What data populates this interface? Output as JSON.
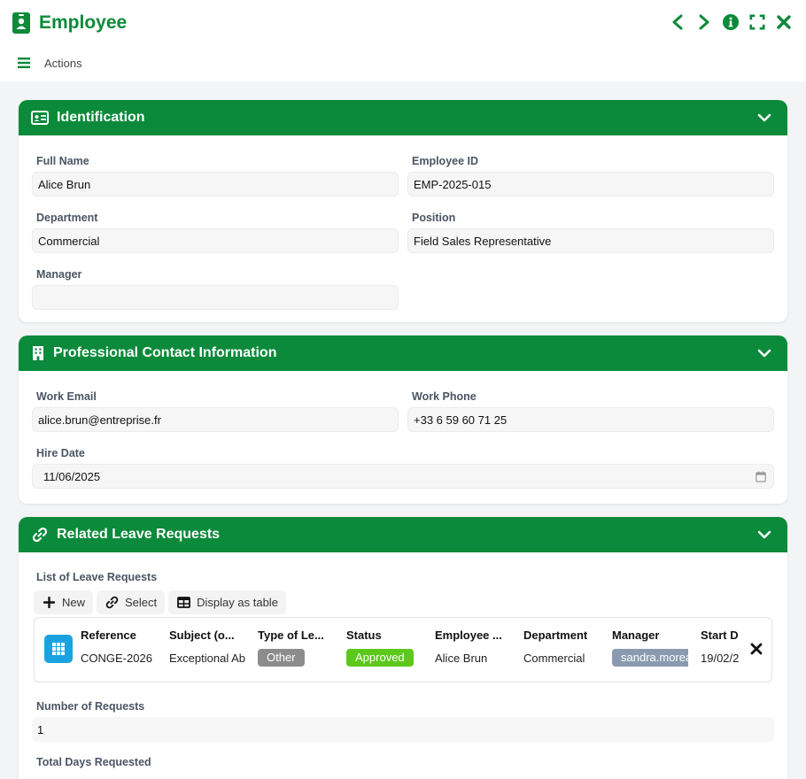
{
  "header": {
    "title": "Employee",
    "actions_label": "Actions"
  },
  "colors": {
    "brand": "#0a8a3a",
    "approved": "#5cc81a",
    "other": "#8c8c8c",
    "manager_tag": "#8a9ab0",
    "record_icon": "#1aa3e0"
  },
  "identification": {
    "title": "Identification",
    "full_name": {
      "label": "Full Name",
      "value": "Alice Brun"
    },
    "employee_id": {
      "label": "Employee ID",
      "value": "EMP-2025-015"
    },
    "department": {
      "label": "Department",
      "value": "Commercial"
    },
    "position": {
      "label": "Position",
      "value": "Field Sales Representative"
    },
    "manager": {
      "label": "Manager",
      "value": ""
    }
  },
  "contact": {
    "title": "Professional Contact Information",
    "work_email": {
      "label": "Work Email",
      "value": "alice.brun@entreprise.fr"
    },
    "work_phone": {
      "label": "Work Phone",
      "value": "+33 6 59 60 71 25"
    },
    "hire_date": {
      "label": "Hire Date",
      "value": "11/06/2025"
    }
  },
  "leave": {
    "title": "Related Leave Requests",
    "list_label": "List of Leave Requests",
    "buttons": {
      "new": "New",
      "select": "Select",
      "display_table": "Display as table"
    },
    "columns": [
      "Reference",
      "Subject (o...",
      "Type of Le...",
      "Status",
      "Employee ...",
      "Department",
      "Manager",
      "Start D"
    ],
    "record": {
      "reference": "CONGE-2026",
      "subject": "Exceptional Ab",
      "type": "Other",
      "status": "Approved",
      "employee": "Alice Brun",
      "department": "Commercial",
      "manager": "sandra.moreau",
      "start_date": "19/02/2"
    },
    "num_requests": {
      "label": "Number of Requests",
      "value": "1"
    },
    "total_days": {
      "label": "Total Days Requested"
    }
  }
}
